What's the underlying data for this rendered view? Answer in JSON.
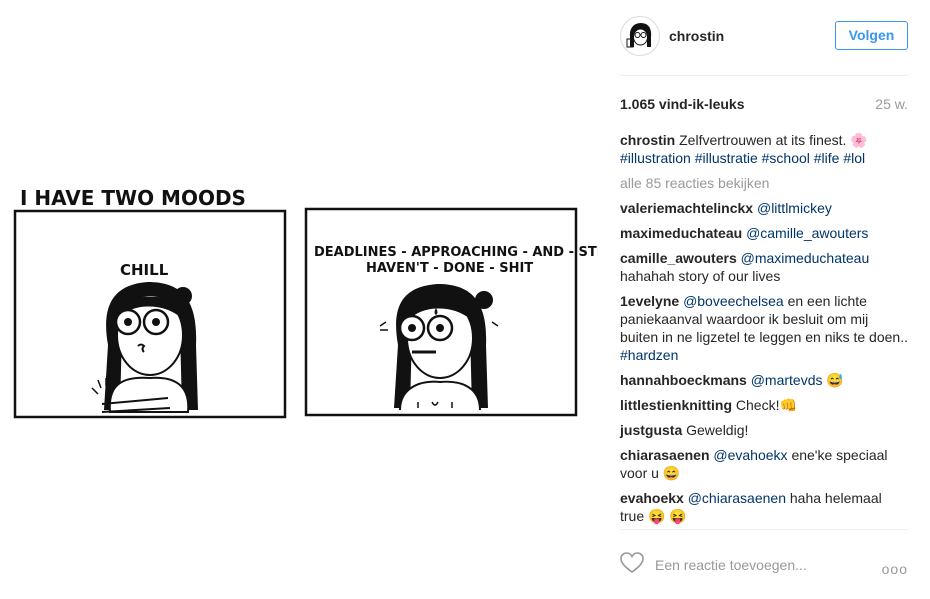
{
  "comic": {
    "heading": "I HAVE TWO MOODS",
    "panel1_label": "CHILL",
    "panel2_line1": "DEADLINES - APPROACHING - AND - STILL",
    "panel2_line2": "HAVEN'T - DONE - SHIT"
  },
  "post": {
    "username": "chrostin",
    "follow_label": "Volgen",
    "likes": "1.065 vind-ik-leuks",
    "age": "25 w.",
    "caption_user": "chrostin",
    "caption_text": "Zelfvertrouwen at its finest. 🌸",
    "caption_tags": "#illustration #illustratie #school #life #lol",
    "view_all": "alle 85 reacties bekijken",
    "comments": [
      {
        "user": "valeriemachtelinckx",
        "mention": "@littlmickey",
        "text": ""
      },
      {
        "user": "maximeduchateau",
        "mention": "@camille_awouters",
        "text": ""
      },
      {
        "user": "camille_awouters",
        "mention": "@maximeduchateau",
        "text": "hahahah story of our lives"
      },
      {
        "user": "1evelyne",
        "mention": "@boveechelsea",
        "text": "en een lichte paniekaanval waardoor ik besluit om mij buiten in ne ligzetel te leggen en niks te doen..",
        "tag": "#hardzen"
      },
      {
        "user": "hannahboeckmans",
        "mention": "@martevds",
        "text": "😅"
      },
      {
        "user": "littlestienknitting",
        "mention": "",
        "text": "Check!👊"
      },
      {
        "user": "justgusta",
        "mention": "",
        "text": "Geweldig!"
      },
      {
        "user": "chiarasaenen",
        "mention": "@evahoekx",
        "text": "ene'ke speciaal voor u 😄"
      },
      {
        "user": "evahoekx",
        "mention": "@chiarasaenen",
        "text": "haha helemaal true 😝 😝"
      }
    ],
    "reply_placeholder": "Een reactie toevoegen...",
    "more_label": "ooo"
  },
  "icons": {
    "avatar": "avatar-illustration",
    "heart": "heart-outline-icon",
    "more": "more-options-icon"
  }
}
